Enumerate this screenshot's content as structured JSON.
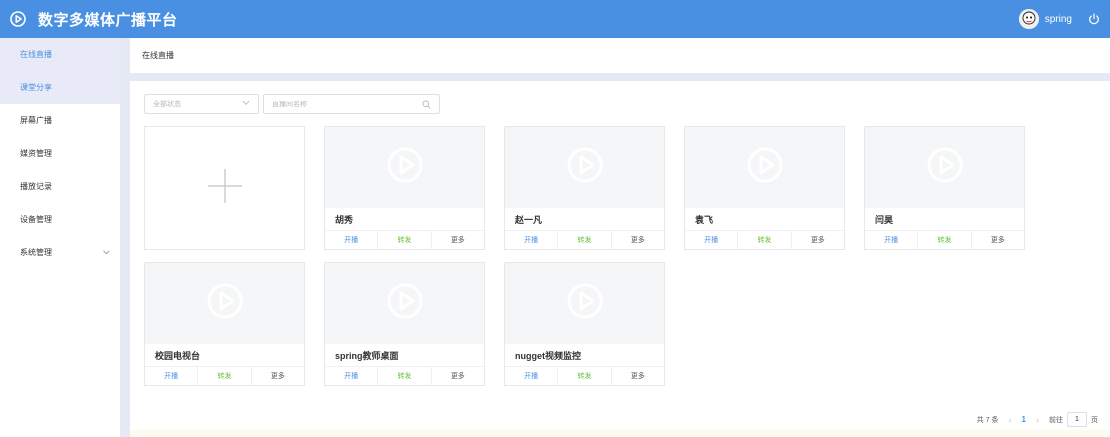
{
  "header": {
    "app_title": "数字多媒体广播平台",
    "username": "spring",
    "logo_icon": "play-logo-icon",
    "power_icon": "power-icon",
    "bg_color": "#4a90e2"
  },
  "sidebar": {
    "items": [
      {
        "label": "在线直播",
        "active": true
      },
      {
        "label": "课堂分享",
        "active": true
      },
      {
        "label": "屏幕广播",
        "active": false
      },
      {
        "label": "媒资管理",
        "active": false
      },
      {
        "label": "播放记录",
        "active": false
      },
      {
        "label": "设备管理",
        "active": false
      },
      {
        "label": "系统管理",
        "active": false,
        "has_submenu": true
      }
    ]
  },
  "breadcrumb": {
    "current": "在线直播"
  },
  "filters": {
    "status_select": {
      "value": "全部状态"
    },
    "name_search": {
      "placeholder": "直播间名称",
      "value": ""
    }
  },
  "cards": [
    {
      "name": "胡秀",
      "play": "开播",
      "forward": "转发",
      "more": "更多"
    },
    {
      "name": "赵一凡",
      "play": "开播",
      "forward": "转发",
      "more": "更多"
    },
    {
      "name": "袁飞",
      "play": "开播",
      "forward": "转发",
      "more": "更多"
    },
    {
      "name": "闫昊",
      "play": "开播",
      "forward": "转发",
      "more": "更多"
    },
    {
      "name": "校园电视台",
      "play": "开播",
      "forward": "转发",
      "more": "更多"
    },
    {
      "name": "spring教师桌面",
      "play": "开播",
      "forward": "转发",
      "more": "更多"
    },
    {
      "name": "nugget视频监控",
      "play": "开播",
      "forward": "转发",
      "more": "更多"
    }
  ],
  "pagination": {
    "total": "共 7 条",
    "current_page": "1",
    "goto_label": "前往",
    "goto_value": "1",
    "page_suffix": "页"
  },
  "colors": {
    "accent": "#4a90e2",
    "forward": "#67c23a",
    "sidebar_active_bg": "#e8ebf7"
  }
}
